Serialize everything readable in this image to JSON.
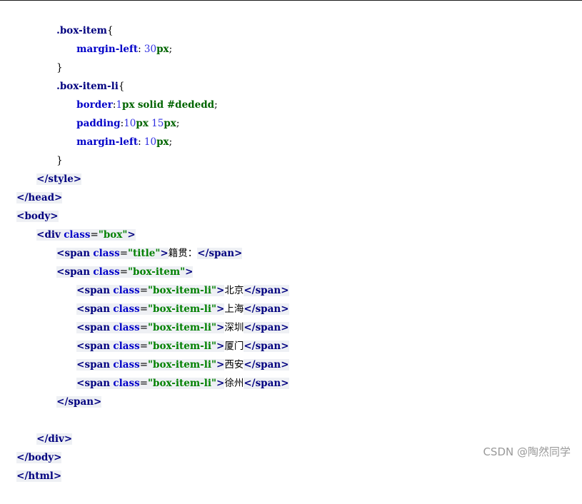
{
  "code": {
    "css": {
      "box_item": {
        "selector": ".box-item",
        "open": "{",
        "prop": "margin-left",
        "num": "30",
        "unit": "px",
        "close": "}"
      },
      "box_item_li": {
        "selector": ".box-item-li",
        "open": "{",
        "border": {
          "prop": "border",
          "num": "1",
          "unit": "px",
          "value": "solid #dededd"
        },
        "padding": {
          "prop": "padding",
          "num1": "10",
          "unit1": "px",
          "num2": "15",
          "unit2": "px"
        },
        "margin": {
          "prop": "margin-left",
          "num": "10",
          "unit": "px"
        },
        "close": "}"
      },
      "style_close": "</style>"
    },
    "head_close": "</head>",
    "body_open": "<body>",
    "div": {
      "tag": "div",
      "attr": "class",
      "value": "\"box\""
    },
    "title_span": {
      "tag": "span",
      "attr": "class",
      "value": "\"title\"",
      "text": "籍贯："
    },
    "item_span": {
      "tag": "span",
      "attr": "class",
      "value": "\"box-item\""
    },
    "li_value": "\"box-item-li\"",
    "cities": [
      "北京",
      "上海",
      "深圳",
      "厦门",
      "西安",
      "徐州"
    ],
    "span_close": "</span>",
    "div_close": "</div>",
    "body_close": "</body>",
    "html_close": "</html>"
  },
  "watermark": "CSDN @陶然同学"
}
